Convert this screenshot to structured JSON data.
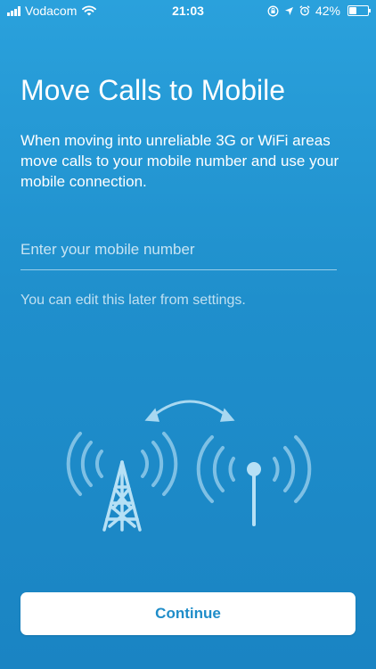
{
  "status_bar": {
    "carrier": "Vodacom",
    "time": "21:03",
    "battery_percent": "42%",
    "battery_level": 0.42,
    "icons": [
      "signal-icon",
      "wifi-icon",
      "orientation-lock-icon",
      "location-arrow-icon",
      "alarm-icon",
      "battery-icon"
    ]
  },
  "screen": {
    "title": "Move Calls to Mobile",
    "description": "When moving into unreliable 3G or WiFi areas move calls to your mobile number and use your mobile connection.",
    "mobile_input": {
      "value": "",
      "placeholder": "Enter your mobile number"
    },
    "hint": "You can edit this later from settings.",
    "illustration_icons": [
      "swap-arrows-icon",
      "cell-tower-icon",
      "antenna-icon"
    ],
    "continue_label": "Continue"
  },
  "colors": {
    "background_top": "#2aa1dc",
    "background_bottom": "#1a84c3",
    "button_background": "#ffffff",
    "button_text": "#1f8dc9",
    "illustration": "#9fd3ef"
  }
}
